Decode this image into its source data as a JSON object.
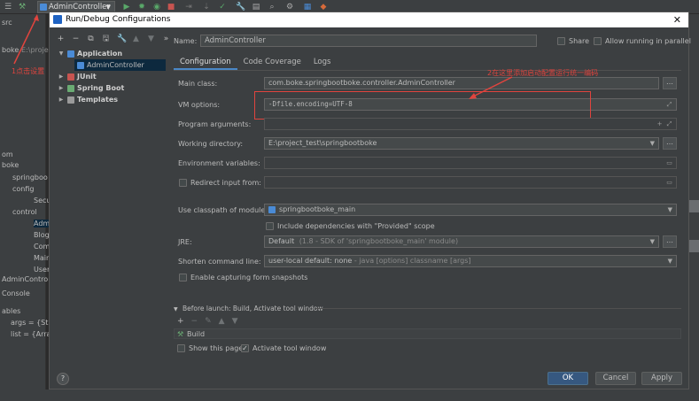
{
  "ide": {
    "run_config": "AdminController",
    "left_texts": [
      "src",
      "boke",
      "E:\\project_t",
      "om",
      "boke",
      "springboo",
      "config",
      "Secu",
      "control",
      "Adm",
      "Blog",
      "Com",
      "Main",
      "User",
      "AdminController",
      "Console",
      "ables",
      "args = {Strin",
      "list = {Array"
    ],
    "annotation_left": "1点击设置"
  },
  "dialog": {
    "title": "Run/Debug Configurations",
    "close": "✕",
    "toolbar": [
      "+",
      "−",
      "⧉",
      "🖫",
      "🔧",
      "▲",
      "▼",
      "»"
    ],
    "tree": [
      {
        "label": "Application",
        "bold": true
      },
      {
        "label": "AdminController",
        "selected": true
      },
      {
        "label": "JUnit",
        "bold": true
      },
      {
        "label": "Spring Boot",
        "bold": true
      },
      {
        "label": "Templates",
        "bold": true
      }
    ],
    "name_label": "Name:",
    "name_value": "AdminController",
    "share_label": "Share",
    "allow_parallel_label": "Allow running in parallel",
    "tabs": [
      "Configuration",
      "Code Coverage",
      "Logs"
    ],
    "main_class_label": "Main class:",
    "main_class_value": "com.boke.springbootboke.controller.AdminController",
    "vm_options_label": "VM options:",
    "vm_options_value": "-Dfile.encoding=UTF-8",
    "program_args_label": "Program arguments:",
    "program_args_value": "",
    "working_dir_label": "Working directory:",
    "working_dir_value": "E:\\project_test\\springbootboke",
    "env_vars_label": "Environment variables:",
    "env_vars_value": "",
    "redirect_label": "Redirect input from:",
    "redirect_value": "",
    "classpath_label": "Use classpath of module:",
    "classpath_value": "springbootboke_main",
    "include_deps_label": "Include dependencies with \"Provided\" scope",
    "jre_label": "JRE:",
    "jre_value_main": "Default",
    "jre_value_hint": "(1.8 - SDK of 'springbootboke_main' module)",
    "shorten_label": "Shorten command line:",
    "shorten_value_main": "user-local default: none",
    "shorten_value_hint": " - java [options] classname [args]",
    "snapshots_label": "Enable capturing form snapshots",
    "before_launch_label": "Before launch: Build, Activate tool window",
    "build_item": "Build",
    "show_page_label": "Show this page",
    "activate_tool_label": "Activate tool window",
    "annotation_right": "2在这里添加启动配置运行统一编码",
    "ok_label": "OK",
    "cancel_label": "Cancel",
    "apply_label": "Apply",
    "help_label": "?"
  },
  "colors": {
    "accent": "#365880",
    "annotation": "#e0443e",
    "background": "#3c3f41"
  }
}
